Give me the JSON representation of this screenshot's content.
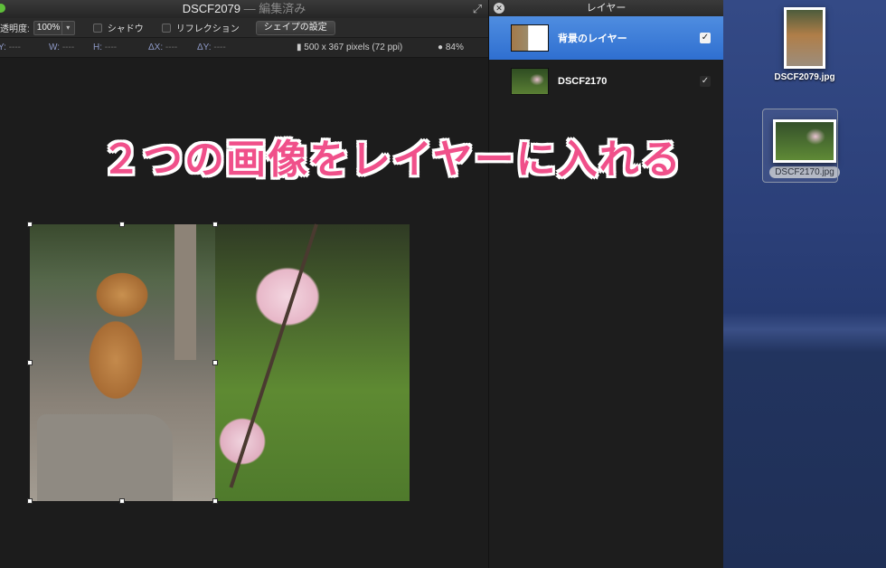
{
  "window": {
    "doc_name": "DSCF2079",
    "edited_suffix": " — 編集済み"
  },
  "toolbar": {
    "opacity_label": "透明度:",
    "opacity_value": "100%",
    "shadow_label": "シャドウ",
    "reflection_label": "リフレクション",
    "shape_settings_label": "シェイプの設定"
  },
  "info_bar": {
    "y_label": "Y:",
    "y_value": "----",
    "w_label": "W:",
    "w_value": "----",
    "h_label": "H:",
    "h_value": "----",
    "dx_label": "ΔX:",
    "dx_value": "----",
    "dy_label": "ΔY:",
    "dy_value": "----",
    "size_text": "500 x 367 pixels (72 ppi)",
    "zoom_text": "84%"
  },
  "layers_panel": {
    "title": "レイヤー",
    "layers": [
      {
        "name": "背景のレイヤー",
        "visible": true,
        "selected": true
      },
      {
        "name": "DSCF2170",
        "visible": true,
        "selected": false
      }
    ]
  },
  "caption": "２つの画像をレイヤーに入れる",
  "desktop": {
    "files": [
      {
        "name": "DSCF2079.jpg"
      },
      {
        "name": "DSCF2170.jpg"
      }
    ]
  },
  "colors": {
    "accent_selection": "#2f6fd0",
    "caption_pink": "#f0508a"
  }
}
